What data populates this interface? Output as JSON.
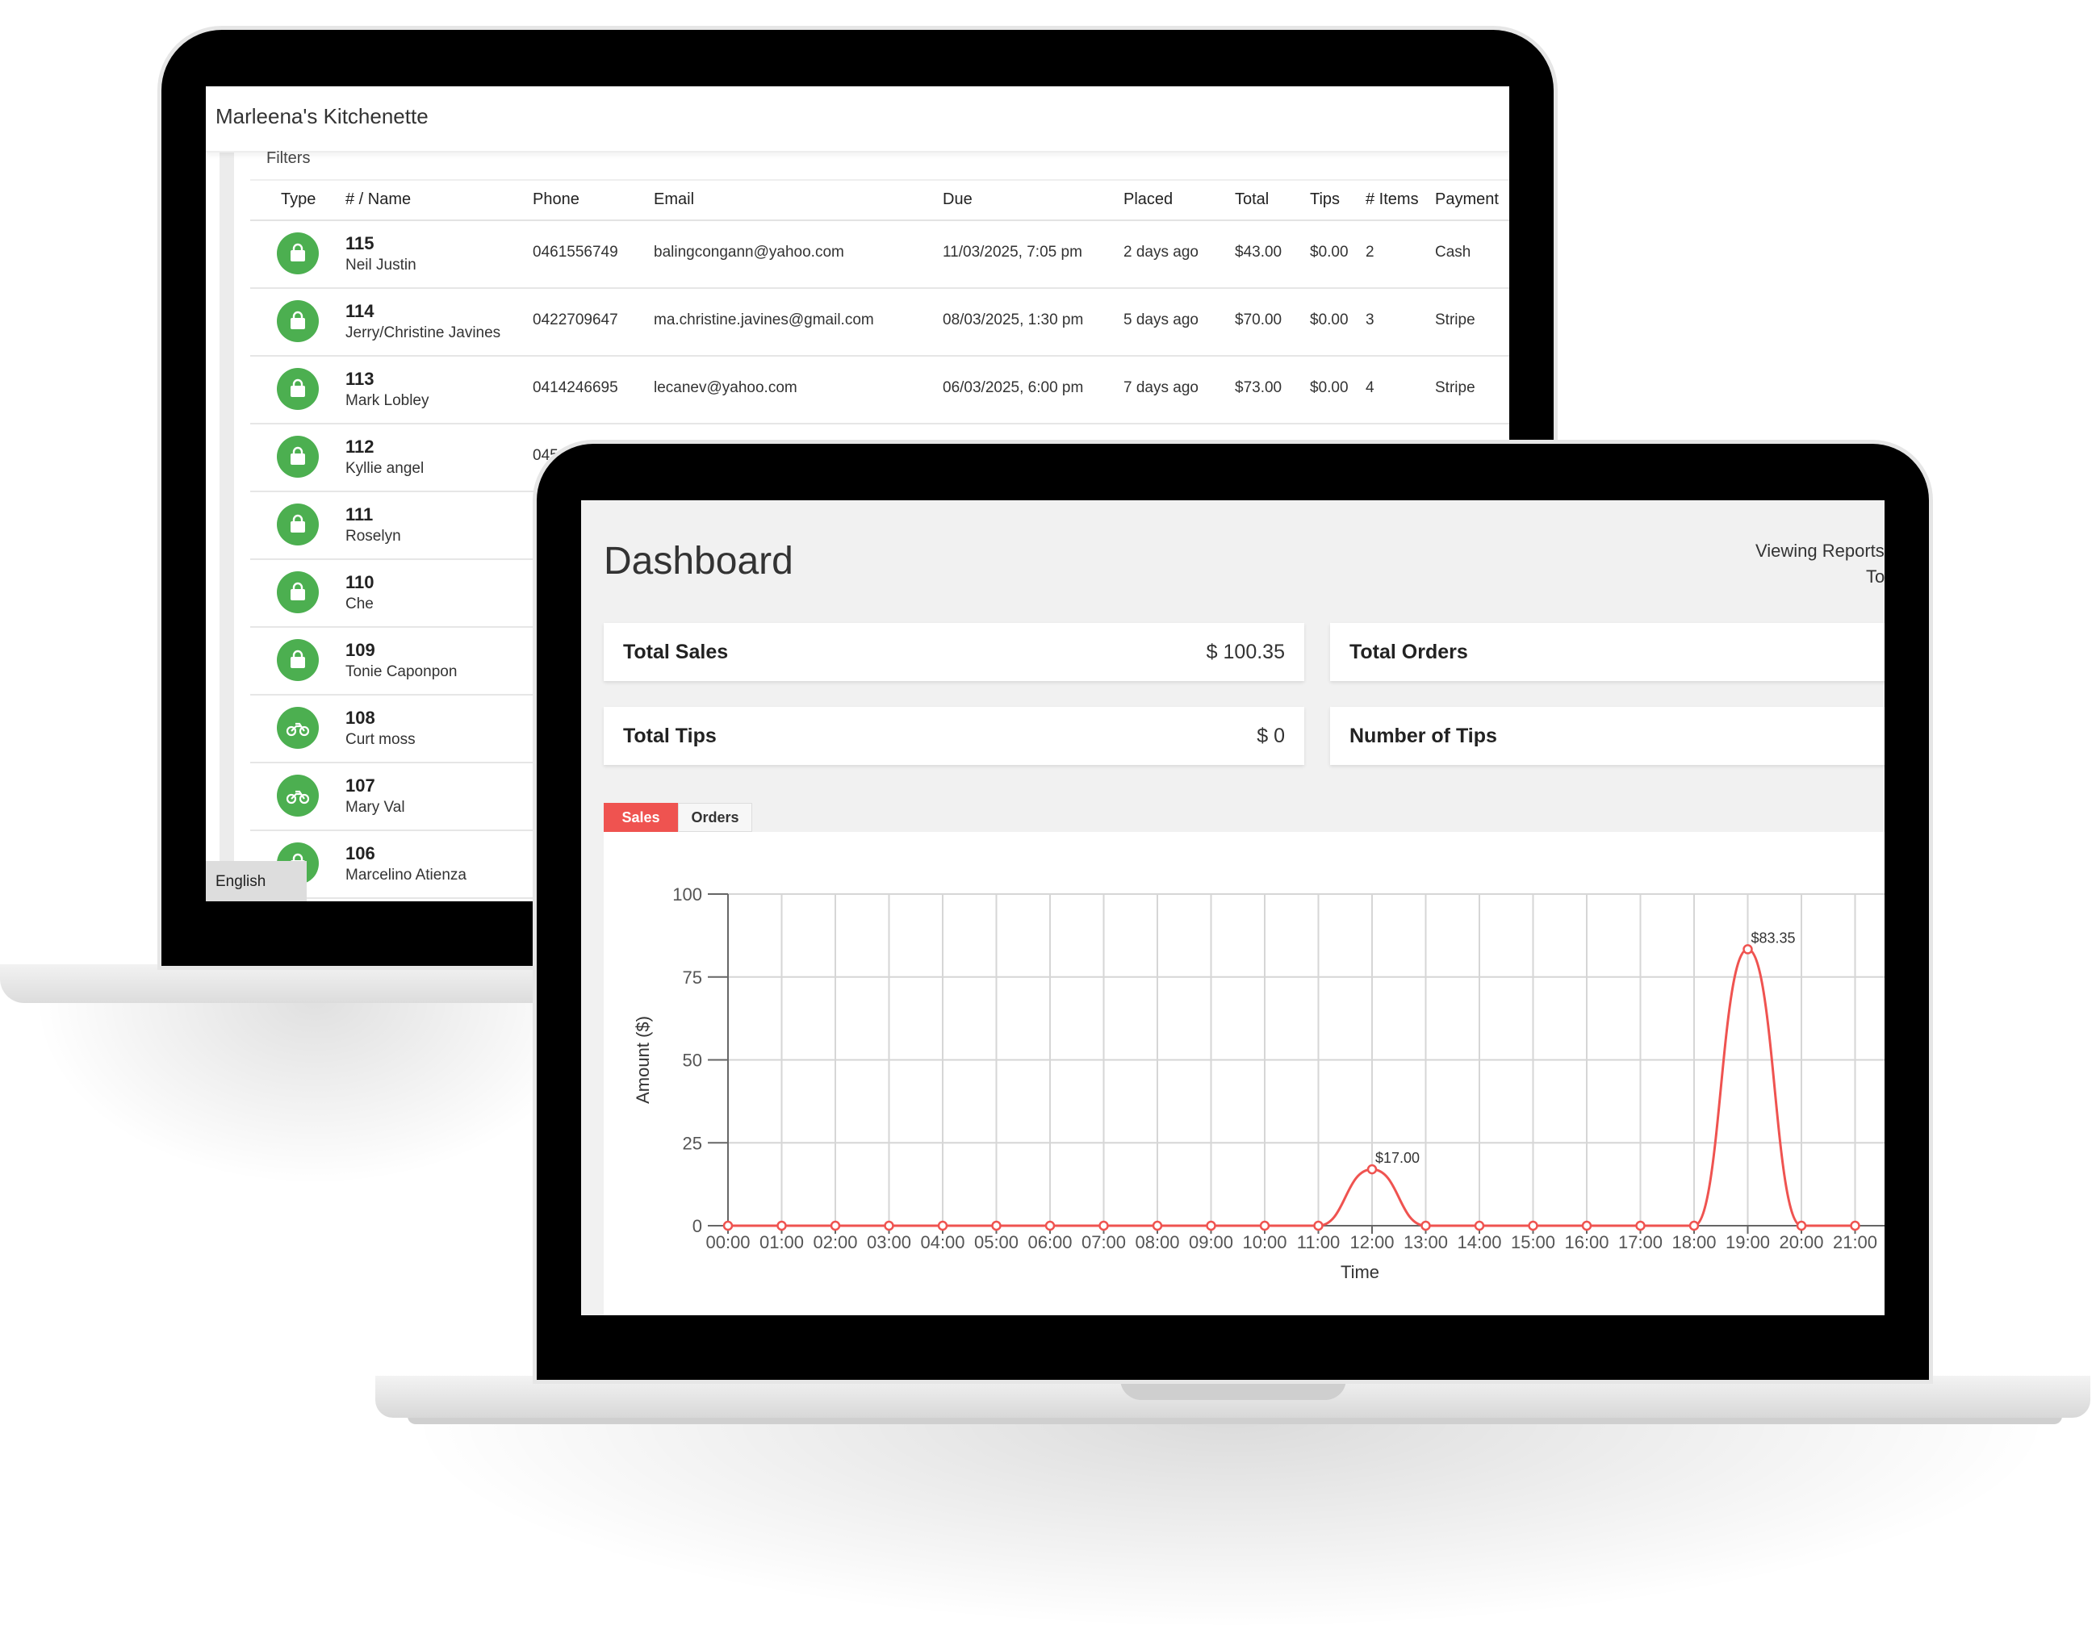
{
  "orders_app": {
    "title": "Marleena's Kitchenette",
    "filters_label": "Filters",
    "language": "English",
    "columns": [
      "Type",
      "# / Name",
      "Phone",
      "Email",
      "Due",
      "Placed",
      "Total",
      "Tips",
      "# Items",
      "Payment"
    ],
    "rows": [
      {
        "type_icon": "shopping-bag-icon",
        "number": "115",
        "name": "Neil Justin",
        "phone": "0461556749",
        "email": "balingcongann@yahoo.com",
        "due": "11/03/2025, 7:05 pm",
        "placed": "2 days ago",
        "total": "$43.00",
        "tips": "$0.00",
        "items": "2",
        "payment": "Cash"
      },
      {
        "type_icon": "shopping-bag-icon",
        "number": "114",
        "name": "Jerry/Christine Javines",
        "phone": "0422709647",
        "email": "ma.christine.javines@gmail.com",
        "due": "08/03/2025, 1:30 pm",
        "placed": "5 days ago",
        "total": "$70.00",
        "tips": "$0.00",
        "items": "3",
        "payment": "Stripe"
      },
      {
        "type_icon": "shopping-bag-icon",
        "number": "113",
        "name": "Mark Lobley",
        "phone": "0414246695",
        "email": "lecanev@yahoo.com",
        "due": "06/03/2025, 6:00 pm",
        "placed": "7 days ago",
        "total": "$73.00",
        "tips": "$0.00",
        "items": "4",
        "payment": "Stripe"
      },
      {
        "type_icon": "shopping-bag-icon",
        "number": "112",
        "name": "Kyllie angel",
        "phone": "045"
      },
      {
        "type_icon": "shopping-bag-icon",
        "number": "111",
        "name": "Roselyn"
      },
      {
        "type_icon": "shopping-bag-icon",
        "number": "110",
        "name": "Che"
      },
      {
        "type_icon": "shopping-bag-icon",
        "number": "109",
        "name": "Tonie Caponpon"
      },
      {
        "type_icon": "motorbike-icon",
        "number": "108",
        "name": "Curt moss"
      },
      {
        "type_icon": "motorbike-icon",
        "number": "107",
        "name": "Mary Val"
      },
      {
        "type_icon": "shopping-bag-icon",
        "number": "106",
        "name": "Marcelino Atienza"
      }
    ],
    "colors": {
      "type_icon_bg": "#4caf50"
    }
  },
  "dashboard": {
    "title": "Dashboard",
    "viewing_line1": "Viewing Reports",
    "viewing_line2": "To",
    "cards": {
      "total_sales": {
        "label": "Total Sales",
        "value": "$ 100.35"
      },
      "total_orders": {
        "label": "Total Orders",
        "value": ""
      },
      "total_tips": {
        "label": "Total Tips",
        "value": "$ 0"
      },
      "number_of_tips": {
        "label": "Number of Tips",
        "value": ""
      }
    },
    "tabs": [
      "Sales",
      "Orders"
    ],
    "active_tab": "Sales",
    "colors": {
      "accent": "#ef5350"
    }
  },
  "chart_data": {
    "type": "line",
    "xlabel": "Time",
    "ylabel": "Amount ($)",
    "ylim": [
      0,
      100
    ],
    "yticks": [
      0,
      25,
      50,
      75,
      100
    ],
    "grid": true,
    "x": [
      "00:00",
      "01:00",
      "02:00",
      "03:00",
      "04:00",
      "05:00",
      "06:00",
      "07:00",
      "08:00",
      "09:00",
      "10:00",
      "11:00",
      "12:00",
      "13:00",
      "14:00",
      "15:00",
      "16:00",
      "17:00",
      "18:00",
      "19:00",
      "20:00",
      "21:00"
    ],
    "series": [
      {
        "values": [
          0,
          0,
          0,
          0,
          0,
          0,
          0,
          0,
          0,
          0,
          0,
          0,
          17.0,
          0,
          0,
          0,
          0,
          0,
          0,
          83.35,
          0,
          0
        ],
        "color": "#ef5350"
      }
    ],
    "annotations": [
      {
        "x": "12:00",
        "label": "$17.00"
      },
      {
        "x": "19:00",
        "label": "$83.35"
      }
    ]
  }
}
